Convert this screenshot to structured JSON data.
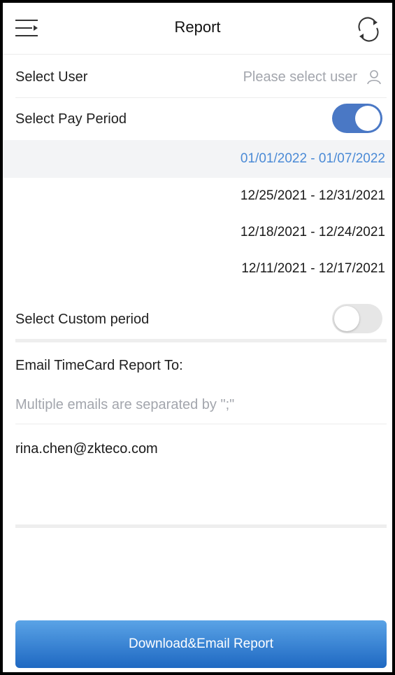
{
  "header": {
    "title": "Report",
    "menu_icon": "menu-collapse-icon",
    "refresh_icon": "refresh-icon"
  },
  "select_user": {
    "label": "Select User",
    "placeholder": "Please select user",
    "icon": "user-icon"
  },
  "pay_period": {
    "label": "Select Pay Period",
    "toggle_on": true,
    "options": [
      {
        "label": "01/01/2022 - 01/07/2022",
        "selected": true
      },
      {
        "label": "12/25/2021 - 12/31/2021",
        "selected": false
      },
      {
        "label": "12/18/2021 - 12/24/2021",
        "selected": false
      },
      {
        "label": "12/11/2021 - 12/17/2021",
        "selected": false
      }
    ]
  },
  "custom_period": {
    "label": "Select Custom period",
    "toggle_on": false
  },
  "email": {
    "label": "Email TimeCard Report To:",
    "placeholder": "Multiple emails are separated by \";\"",
    "value": "rina.chen@zkteco.com"
  },
  "action": {
    "button_label": "Download&Email Report"
  },
  "colors": {
    "accent": "#4a78c5",
    "selected_text": "#4a8ad6",
    "placeholder": "#a3a6ad",
    "button_top": "#5aa3e6",
    "button_bottom": "#1e68c2"
  }
}
